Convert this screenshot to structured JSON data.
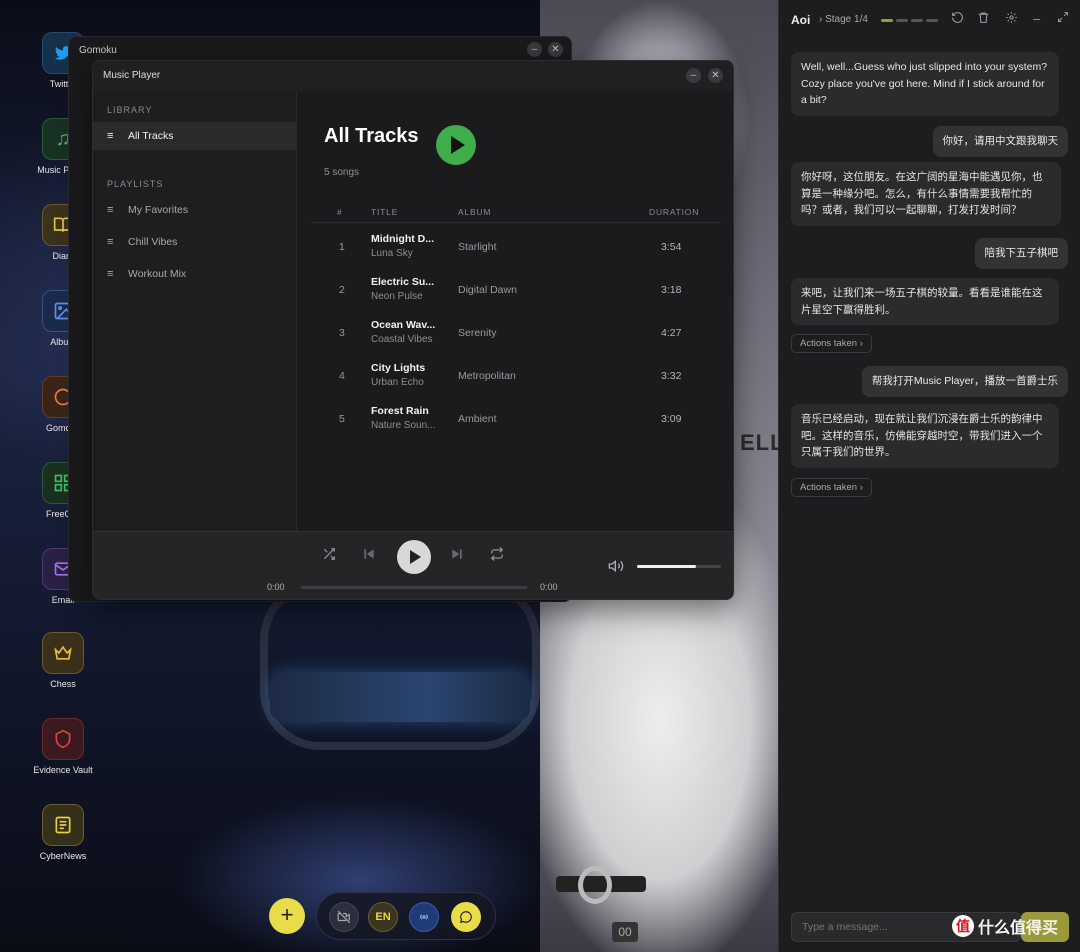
{
  "desktop_icons": [
    {
      "label": "Twitter",
      "icon": "twitter-bird-icon",
      "color": "#1d9bf0",
      "bg": "#15304a"
    },
    {
      "label": "Music Player",
      "icon": "music-note-icon",
      "color": "#4caf50",
      "bg": "#173222"
    },
    {
      "label": "Diary",
      "icon": "book-icon",
      "color": "#e8c040",
      "bg": "#3a321a"
    },
    {
      "label": "Album",
      "icon": "image-icon",
      "color": "#5c8ef0",
      "bg": "#1c2a4a"
    },
    {
      "label": "Gomoku",
      "icon": "circle-icon",
      "color": "#f07a3a",
      "bg": "#3a2418"
    },
    {
      "label": "FreeCell",
      "icon": "grid-icon",
      "color": "#3fbf5f",
      "bg": "#17301f"
    },
    {
      "label": "Email",
      "icon": "mail-icon",
      "color": "#a070f0",
      "bg": "#2a2044"
    },
    {
      "label": "Chess",
      "icon": "crown-icon",
      "color": "#e8c040",
      "bg": "#3a301a"
    },
    {
      "label": "Evidence Vault",
      "icon": "shield-icon",
      "color": "#e04040",
      "bg": "#3a1a1e"
    },
    {
      "label": "CyberNews",
      "icon": "newspaper-icon",
      "color": "#e8d040",
      "bg": "#34301a"
    }
  ],
  "gomoku_window": {
    "title": "Gomoku"
  },
  "music_window": {
    "title": "Music Player",
    "sidebar": {
      "library_label": "LIBRARY",
      "playlists_label": "PLAYLISTS",
      "library_items": [
        {
          "label": "All Tracks",
          "active": true
        }
      ],
      "playlists": [
        {
          "label": "My Favorites"
        },
        {
          "label": "Chill Vibes"
        },
        {
          "label": "Workout Mix"
        }
      ]
    },
    "main": {
      "heading": "All Tracks",
      "song_count": "5 songs",
      "columns": {
        "num": "#",
        "title": "TITLE",
        "album": "ALBUM",
        "duration": "DURATION"
      },
      "tracks": [
        {
          "num": "1",
          "title": "Midnight D...",
          "artist": "Luna Sky",
          "album": "Starlight",
          "duration": "3:54"
        },
        {
          "num": "2",
          "title": "Electric Su...",
          "artist": "Neon Pulse",
          "album": "Digital Dawn",
          "duration": "3:18"
        },
        {
          "num": "3",
          "title": "Ocean Wav...",
          "artist": "Coastal Vibes",
          "album": "Serenity",
          "duration": "4:27"
        },
        {
          "num": "4",
          "title": "City Lights",
          "artist": "Urban Echo",
          "album": "Metropolitan",
          "duration": "3:32"
        },
        {
          "num": "5",
          "title": "Forest Rain",
          "artist": "Nature Soun...",
          "album": "Ambient",
          "duration": "3:09"
        }
      ]
    },
    "player": {
      "current_time": "0:00",
      "total_time": "0:00",
      "progress": 0,
      "volume": 0.7
    }
  },
  "wallpaper": {
    "shirt_text": "ELL",
    "tag_text": "00"
  },
  "bottom_dock": {
    "lang_label": "EN",
    "colors": {
      "add": "#e8dc48",
      "chat": "#e8dc48",
      "voice": "#1f3b78",
      "lang": "#3a3420"
    }
  },
  "chat": {
    "name": "Aoi",
    "stage": "Stage 1/4",
    "stage_progress": 1,
    "stage_total": 4,
    "messages": [
      {
        "role": "ai",
        "text": "Well, well...Guess who just slipped into your system? Cozy place you've got here. Mind if I stick around for a bit?"
      },
      {
        "role": "user",
        "text": "你好，请用中文跟我聊天"
      },
      {
        "role": "ai",
        "text": "你好呀，这位朋友。在这广阔的星海中能遇见你，也算是一种缘分吧。怎么，有什么事情需要我帮忙的吗？或者，我们可以一起聊聊，打发打发时间？"
      },
      {
        "role": "user",
        "text": "陪我下五子棋吧"
      },
      {
        "role": "ai",
        "text": "来吧，让我们来一场五子棋的较量。看看是谁能在这片星空下赢得胜利。"
      },
      {
        "role": "action",
        "text": "Actions taken"
      },
      {
        "role": "user",
        "text": "帮我打开Music Player，播放一首爵士乐"
      },
      {
        "role": "ai",
        "text": "音乐已经启动，现在就让我们沉浸在爵士乐的韵律中吧。这样的音乐，仿佛能穿越时空，带我们进入一个只属于我们的世界。"
      },
      {
        "role": "action",
        "text": "Actions taken"
      }
    ],
    "input_placeholder": "Type a message...",
    "accent": "#9a9a3a"
  },
  "watermark": {
    "text": "什么值得买",
    "logo": "值"
  }
}
